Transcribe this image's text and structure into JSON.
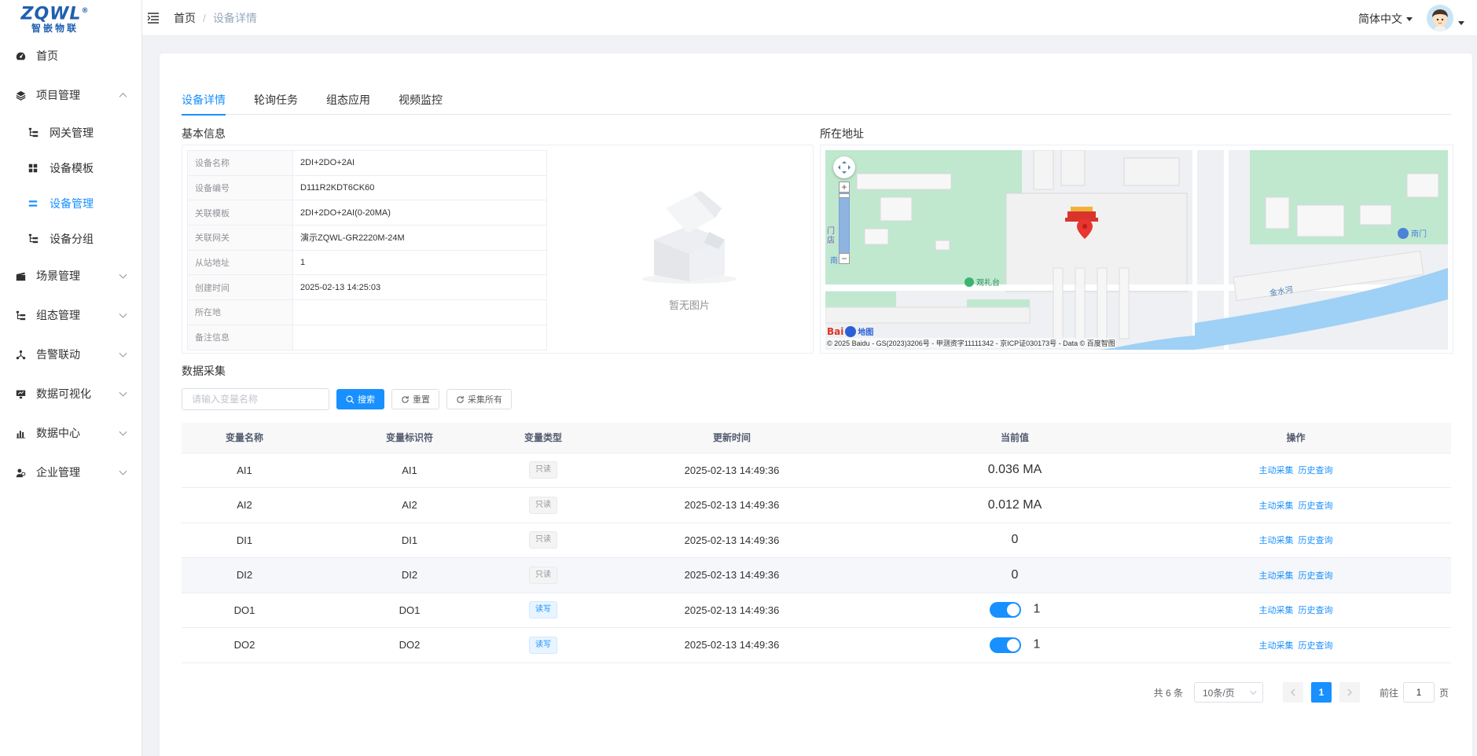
{
  "logo": {
    "main": "ZQWL",
    "registered": "®",
    "sub": "智嵌物联"
  },
  "sidebar": {
    "items": [
      {
        "label": "首页",
        "icon": "dashboard-icon"
      },
      {
        "label": "项目管理",
        "icon": "layers-icon",
        "expanded": true,
        "children": [
          {
            "label": "网关管理",
            "icon": "tree-icon"
          },
          {
            "label": "设备模板",
            "icon": "grid-icon"
          },
          {
            "label": "设备管理",
            "icon": "list-icon",
            "active": true
          },
          {
            "label": "设备分组",
            "icon": "tree-icon"
          }
        ]
      },
      {
        "label": "场景管理",
        "icon": "clapper-icon"
      },
      {
        "label": "组态管理",
        "icon": "tree-icon"
      },
      {
        "label": "告警联动",
        "icon": "network-icon"
      },
      {
        "label": "数据可视化",
        "icon": "monitor-icon"
      },
      {
        "label": "数据中心",
        "icon": "bar-chart-icon"
      },
      {
        "label": "企业管理",
        "icon": "user-group-icon"
      }
    ]
  },
  "header": {
    "breadcrumb": {
      "home": "首页",
      "current": "设备详情",
      "separator": "/"
    },
    "language": "简体中文"
  },
  "tabs": [
    "设备详情",
    "轮询任务",
    "组态应用",
    "视频监控"
  ],
  "basic_info": {
    "title": "基本信息",
    "rows": [
      {
        "key": "设备名称",
        "value": "2DI+2DO+2AI"
      },
      {
        "key": "设备编号",
        "value": "D111R2KDT6CK60"
      },
      {
        "key": "关联模板",
        "value": "2DI+2DO+2AI(0-20MA)"
      },
      {
        "key": "关联网关",
        "value": "演示ZQWL-GR2220M-24M"
      },
      {
        "key": "从站地址",
        "value": "1"
      },
      {
        "key": "创建时间",
        "value": "2025-02-13 14:25:03"
      },
      {
        "key": "所在地",
        "value": ""
      },
      {
        "key": "备注信息",
        "value": ""
      }
    ],
    "no_image": "暂无图片"
  },
  "location": {
    "title": "所在地址",
    "map_labels": {
      "poi": "观礼台",
      "river": "金水河",
      "gate": "南门",
      "left_mark": "门",
      "left_mark2": "店",
      "left_mark3": "南"
    },
    "copyright": "© 2025 Baidu - GS(2023)3206号 - 甲测资字11111342 - 京ICP证030173号 - Data © 百度智图",
    "brand": "Bai",
    "brand2": "地图"
  },
  "collection": {
    "title": "数据采集",
    "search_placeholder": "请输入变量名称",
    "btn_search": "搜索",
    "btn_reset": "重置",
    "btn_collect_all": "采集所有"
  },
  "table": {
    "headers": [
      "变量名称",
      "变量标识符",
      "变量类型",
      "更新时间",
      "当前值",
      "操作"
    ],
    "rows": [
      {
        "name": "AI1",
        "id": "AI1",
        "type": "只读",
        "rw": false,
        "time": "2025-02-13 14:49:36",
        "value": "0.036 MA",
        "switch": false
      },
      {
        "name": "AI2",
        "id": "AI2",
        "type": "只读",
        "rw": false,
        "time": "2025-02-13 14:49:36",
        "value": "0.012 MA",
        "switch": false
      },
      {
        "name": "DI1",
        "id": "DI1",
        "type": "只读",
        "rw": false,
        "time": "2025-02-13 14:49:36",
        "value": "0",
        "switch": false
      },
      {
        "name": "DI2",
        "id": "DI2",
        "type": "只读",
        "rw": false,
        "time": "2025-02-13 14:49:36",
        "value": "0",
        "switch": false
      },
      {
        "name": "DO1",
        "id": "DO1",
        "type": "读写",
        "rw": true,
        "time": "2025-02-13 14:49:36",
        "value": "1",
        "switch": true
      },
      {
        "name": "DO2",
        "id": "DO2",
        "type": "读写",
        "rw": true,
        "time": "2025-02-13 14:49:36",
        "value": "1",
        "switch": true
      }
    ],
    "op_collect": "主动采集",
    "op_history": "历史查询"
  },
  "pagination": {
    "total": "共 6 条",
    "page_size": "10条/页",
    "current_page": "1",
    "goto_label": "前往",
    "goto_value": "1",
    "page_unit": "页"
  },
  "colors": {
    "accent": "#1890ff",
    "brand": "#1f5fb0"
  }
}
